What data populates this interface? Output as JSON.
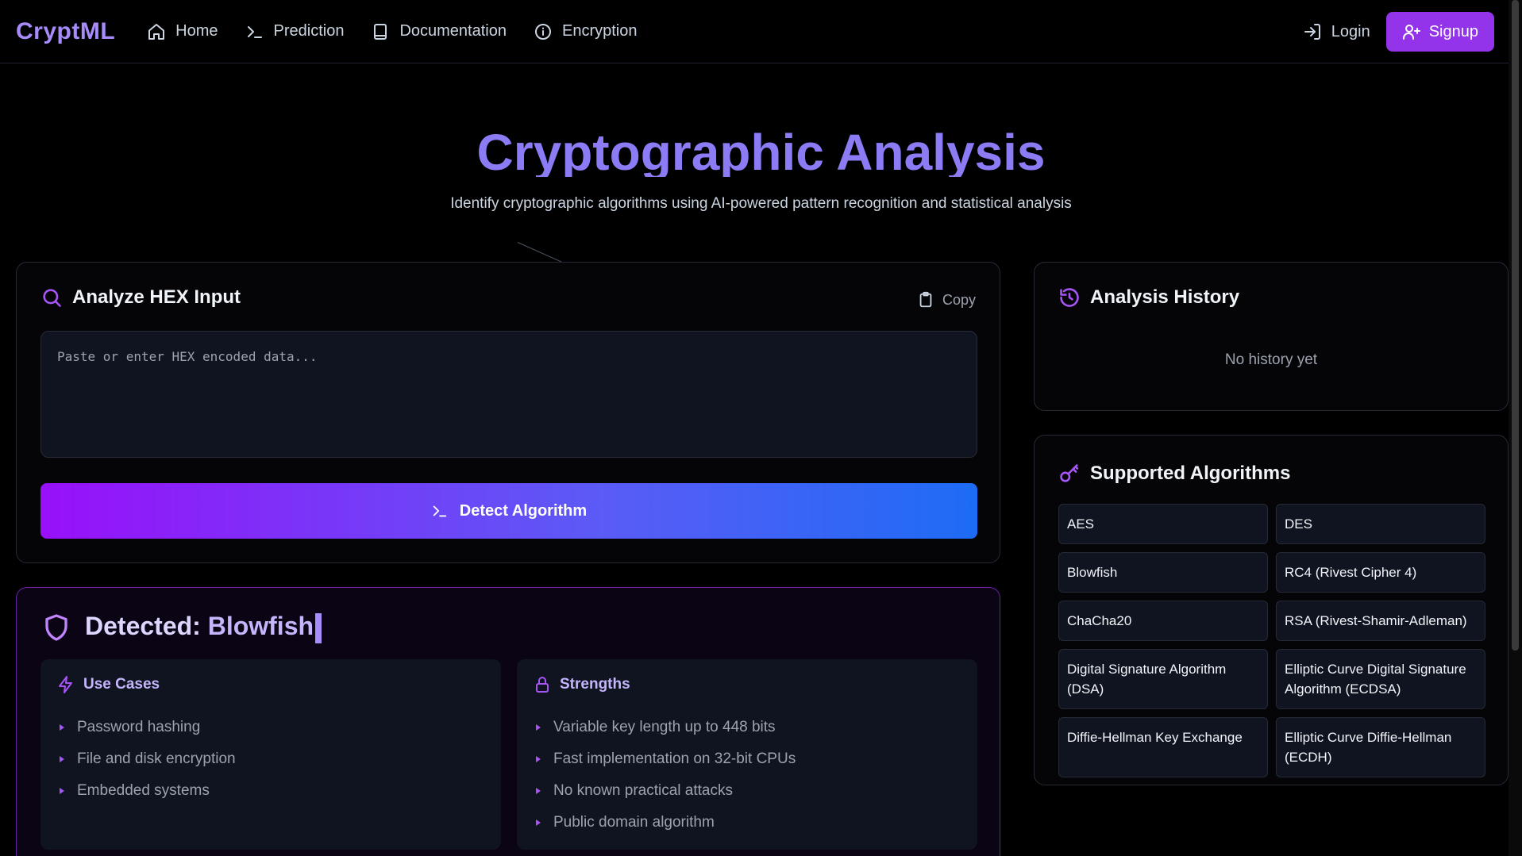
{
  "nav": {
    "brand": "CryptML",
    "links": [
      {
        "label": "Home",
        "icon": "home-icon"
      },
      {
        "label": "Prediction",
        "icon": "terminal-icon"
      },
      {
        "label": "Documentation",
        "icon": "book-icon"
      },
      {
        "label": "Encryption",
        "icon": "info-icon"
      }
    ],
    "login": "Login",
    "signup": "Signup"
  },
  "hero": {
    "title": "Cryptographic Analysis",
    "subtitle": "Identify cryptographic algorithms using AI-powered pattern recognition and statistical analysis"
  },
  "analyze": {
    "title": "Analyze HEX Input",
    "copy": "Copy",
    "placeholder": "Paste or enter HEX encoded data...",
    "value": "",
    "button": "Detect Algorithm"
  },
  "result": {
    "prefix": "Detected:",
    "algorithm": "Blowfish",
    "use_cases": {
      "title": "Use Cases",
      "items": [
        "Password hashing",
        "File and disk encryption",
        "Embedded systems"
      ]
    },
    "strengths": {
      "title": "Strengths",
      "items": [
        "Variable key length up to 448 bits",
        "Fast implementation on 32-bit CPUs",
        "No known practical attacks",
        "Public domain algorithm"
      ]
    }
  },
  "history": {
    "title": "Analysis History",
    "empty": "No history yet"
  },
  "algorithms": {
    "title": "Supported Algorithms",
    "items": [
      "AES",
      "DES",
      "Blowfish",
      "RC4 (Rivest Cipher 4)",
      "ChaCha20",
      "RSA (Rivest-Shamir-Adleman)",
      "Digital Signature Algorithm (DSA)",
      "Elliptic Curve Digital Signature Algorithm (ECDSA)",
      "Diffie-Hellman Key Exchange",
      "Elliptic Curve Diffie-Hellman (ECDH)"
    ]
  },
  "colors": {
    "accent": "#a855f7",
    "brand": "#a78bfa",
    "signup_bg": "#9333ea",
    "gradient_start": "#9810fa",
    "gradient_end": "#1d6cf5"
  }
}
